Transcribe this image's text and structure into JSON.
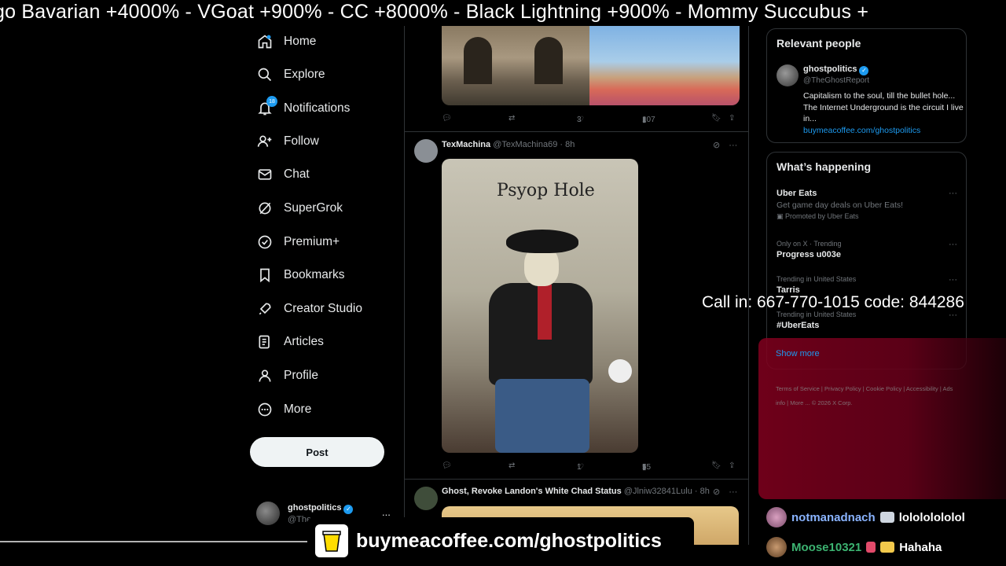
{
  "ticker": {
    "text": "go Bavarian +4000%   -  VGoat +900%   -  CC +8000%   -  Black Lightning +900%   -  Mommy Succubus +"
  },
  "nav": {
    "items": [
      {
        "label": "Home",
        "icon": "home-icon"
      },
      {
        "label": "Explore",
        "icon": "search-icon"
      },
      {
        "label": "Notifications",
        "icon": "bell-icon",
        "badge": "18"
      },
      {
        "label": "Follow",
        "icon": "person-plus-icon"
      },
      {
        "label": "Chat",
        "icon": "mail-icon"
      },
      {
        "label": "SuperGrok",
        "icon": "grok-icon"
      },
      {
        "label": "Premium+",
        "icon": "verified-icon"
      },
      {
        "label": "Bookmarks",
        "icon": "bookmark-icon"
      },
      {
        "label": "Creator Studio",
        "icon": "rocket-icon"
      },
      {
        "label": "Articles",
        "icon": "article-icon"
      },
      {
        "label": "Profile",
        "icon": "person-icon"
      },
      {
        "label": "More",
        "icon": "more-circle-icon"
      }
    ],
    "post_label": "Post",
    "account": {
      "name": "ghostpolitics",
      "handle": "@The",
      "more": "..."
    }
  },
  "feed": {
    "tweet1_stats": {
      "likes": "3",
      "views": "107"
    },
    "tweet2": {
      "name": "TexMachina",
      "handle_time": "@TexMachina69 · 8h",
      "image_text": "Psyop Hole",
      "stats": {
        "likes": "1",
        "views": "55"
      }
    },
    "tweet3": {
      "name": "Ghost, Revoke Landon's White Chad Status",
      "handle_time": "@Jlniw32841Lulu · 8h"
    }
  },
  "relevant": {
    "title": "Relevant people",
    "name": "ghostpolitics",
    "handle": "@TheGhostReport",
    "bio": "Capitalism to the soul, till the bullet hole... The Internet Underground is the circuit I live in...",
    "link": "buymeacoffee.com/ghostpolitics"
  },
  "happening": {
    "title": "What’s happening",
    "trends": [
      {
        "title": "Uber Eats",
        "desc": "Get game day deals on Uber Eats!",
        "promo": "Promoted by Uber Eats"
      },
      {
        "context": "Only on X · Trending",
        "title": "Progress u003e"
      },
      {
        "context": "Trending in United States",
        "title": "Tarris"
      },
      {
        "context": "Trending in United States",
        "title": "#UberEats"
      }
    ],
    "show_more": "Show more"
  },
  "footer": {
    "links": "Terms of Service  |  Privacy Policy  |  Cookie Policy  |  Accessibility  |  Ads info  |  More ...  © 2026 X Corp."
  },
  "call_in": "Call in: 667-770-1015 code: 844286",
  "chat": [
    {
      "user": "notmanadnach",
      "msg": "lolololololol",
      "color": "#8ab4ff"
    },
    {
      "user": "Moose10321",
      "msg": "Hahaha",
      "color": "#3cb371"
    }
  ],
  "banner": {
    "text": "buymeacoffee.com/ghostpolitics"
  },
  "colors": {
    "accent": "#1d9bf0",
    "background": "#000000"
  }
}
